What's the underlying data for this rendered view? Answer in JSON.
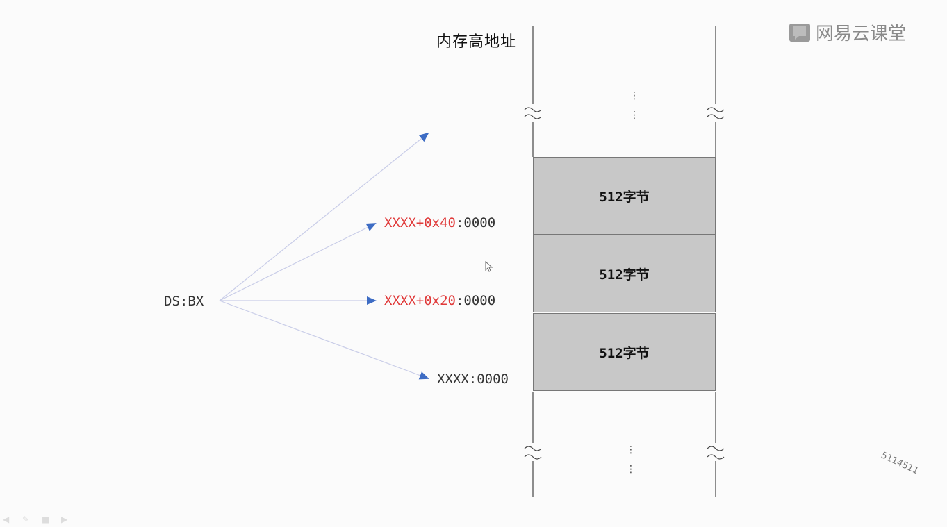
{
  "title": "内存高地址",
  "source": "DS:BX",
  "addresses": [
    {
      "segment": "XXXX+0x40",
      "offset": ":0000"
    },
    {
      "segment": "XXXX+0x20",
      "offset": ":0000"
    },
    {
      "segment": "",
      "plain": "XXXX:0000"
    }
  ],
  "blocks": [
    "512字节",
    "512字节",
    "512字节"
  ],
  "logo": {
    "icon": "book-icon",
    "text": "网易云课堂"
  },
  "watermark": "5114511",
  "colors": {
    "arrow": "#3d6cc4",
    "segment_red": "#e03a3a",
    "block_fill": "#c8c8c8"
  }
}
